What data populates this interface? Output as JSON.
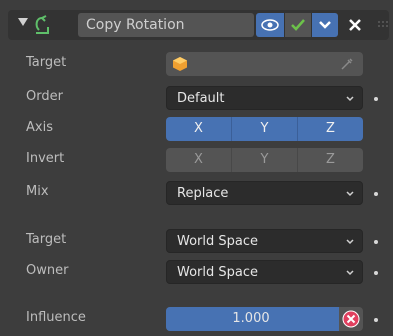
{
  "header": {
    "constraint_name": "Copy Rotation",
    "icons": [
      "collapse-arrow",
      "constraint-icon",
      "eye-icon",
      "check-icon",
      "chevron-down-icon",
      "close-icon",
      "drag-handle"
    ]
  },
  "rows": {
    "target_label": "Target",
    "order_label": "Order",
    "order_value": "Default",
    "axis_label": "Axis",
    "axis": [
      "X",
      "Y",
      "Z"
    ],
    "invert_label": "Invert",
    "invert": [
      "X",
      "Y",
      "Z"
    ],
    "mix_label": "Mix",
    "mix_value": "Replace",
    "space_target_label": "Target",
    "space_target_value": "World Space",
    "owner_label": "Owner",
    "owner_value": "World Space",
    "influence_label": "Influence",
    "influence_value": "1.000",
    "influence_fraction": 1.0
  },
  "colors": {
    "accent": "#4772b3",
    "background": "#3d3d3d",
    "check_green": "#6cc24a",
    "clear_red": "#e0405f"
  }
}
